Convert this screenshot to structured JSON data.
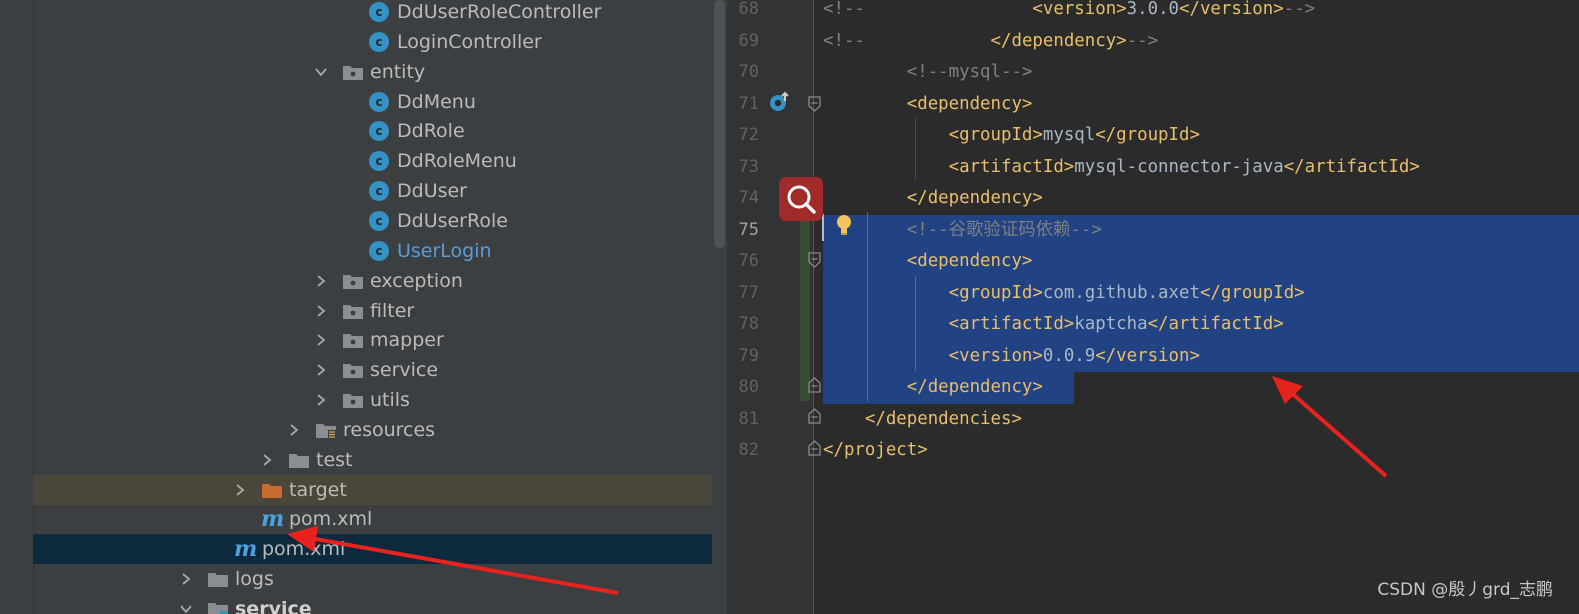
{
  "tree": {
    "items": [
      {
        "label": "DdUserRoleController",
        "icon": "class-icon",
        "expand": "none",
        "depth": 5
      },
      {
        "label": "LoginController",
        "icon": "class-icon",
        "expand": "none",
        "depth": 5
      },
      {
        "label": "entity",
        "icon": "package-icon",
        "expand": "open",
        "depth": 4
      },
      {
        "label": "DdMenu",
        "icon": "class-icon",
        "expand": "none",
        "depth": 5
      },
      {
        "label": "DdRole",
        "icon": "class-icon",
        "expand": "none",
        "depth": 5
      },
      {
        "label": "DdRoleMenu",
        "icon": "class-icon",
        "expand": "none",
        "depth": 5
      },
      {
        "label": "DdUser",
        "icon": "class-icon",
        "expand": "none",
        "depth": 5
      },
      {
        "label": "DdUserRole",
        "icon": "class-icon",
        "expand": "none",
        "depth": 5
      },
      {
        "label": "UserLogin",
        "icon": "class-icon",
        "expand": "none",
        "depth": 5,
        "style": "blue"
      },
      {
        "label": "exception",
        "icon": "package-icon",
        "expand": "closed",
        "depth": 4
      },
      {
        "label": "filter",
        "icon": "package-icon",
        "expand": "closed",
        "depth": 4
      },
      {
        "label": "mapper",
        "icon": "package-icon",
        "expand": "closed",
        "depth": 4
      },
      {
        "label": "service",
        "icon": "package-icon",
        "expand": "closed",
        "depth": 4
      },
      {
        "label": "utils",
        "icon": "package-icon",
        "expand": "closed",
        "depth": 4
      },
      {
        "label": "resources",
        "icon": "resources-folder-icon",
        "expand": "closed",
        "depth": 3
      },
      {
        "label": "test",
        "icon": "folder-icon",
        "expand": "closed",
        "depth": 2
      },
      {
        "label": "target",
        "icon": "orange-folder-icon",
        "expand": "closed",
        "depth": 1,
        "style": "target"
      },
      {
        "label": "pom.xml",
        "icon": "maven-icon",
        "expand": "none",
        "depth": 1
      },
      {
        "label": "pom.xml",
        "icon": "maven-icon",
        "expand": "none",
        "depth": 0,
        "style": "selected"
      },
      {
        "label": "logs",
        "icon": "folder-icon",
        "expand": "closed",
        "depth": -1
      },
      {
        "label": "service",
        "icon": "module-folder-icon",
        "expand": "open",
        "depth": -1,
        "style": "bold"
      }
    ]
  },
  "editor": {
    "lines": [
      {
        "n": "68",
        "tokens": [
          {
            "c": "cmt",
            "t": "<!--"
          },
          {
            "c": "cmt",
            "t": "                "
          },
          {
            "c": "tag",
            "t": "<version>"
          },
          {
            "c": "txt",
            "t": "3.0.0"
          },
          {
            "c": "tag",
            "t": "</version>"
          },
          {
            "c": "cmt",
            "t": "-->"
          }
        ]
      },
      {
        "n": "69",
        "tokens": [
          {
            "c": "cmt",
            "t": "<!--"
          },
          {
            "c": "cmt",
            "t": "            "
          },
          {
            "c": "tag",
            "t": "</dependency>"
          },
          {
            "c": "cmt",
            "t": "-->"
          }
        ]
      },
      {
        "n": "70",
        "tokens": [
          {
            "c": "cmt",
            "t": "        <!--mysql-->"
          }
        ]
      },
      {
        "n": "71",
        "tokens": [
          {
            "c": "txt",
            "t": "        "
          },
          {
            "c": "tag",
            "t": "<dependency>"
          }
        ]
      },
      {
        "n": "72",
        "tokens": [
          {
            "c": "txt",
            "t": "            "
          },
          {
            "c": "tag",
            "t": "<groupId>"
          },
          {
            "c": "txt",
            "t": "mysql"
          },
          {
            "c": "tag",
            "t": "</groupId>"
          }
        ]
      },
      {
        "n": "73",
        "tokens": [
          {
            "c": "txt",
            "t": "            "
          },
          {
            "c": "tag",
            "t": "<artifactId>"
          },
          {
            "c": "txt",
            "t": "mysql-connector-java"
          },
          {
            "c": "tag",
            "t": "</artifactId>"
          }
        ]
      },
      {
        "n": "74",
        "tokens": [
          {
            "c": "txt",
            "t": "        "
          },
          {
            "c": "tag",
            "t": "</dependency>"
          }
        ]
      },
      {
        "n": "75",
        "tokens": [
          {
            "c": "cmt",
            "t": "        <!--谷歌验证码依赖-->"
          }
        ],
        "selected": true,
        "current": true
      },
      {
        "n": "76",
        "tokens": [
          {
            "c": "txt",
            "t": "        "
          },
          {
            "c": "tag",
            "t": "<dependency>"
          }
        ],
        "selected": true
      },
      {
        "n": "77",
        "tokens": [
          {
            "c": "txt",
            "t": "            "
          },
          {
            "c": "tag",
            "t": "<groupId>"
          },
          {
            "c": "txt",
            "t": "com.github.axet"
          },
          {
            "c": "tag",
            "t": "</groupId>"
          }
        ],
        "selected": true
      },
      {
        "n": "78",
        "tokens": [
          {
            "c": "txt",
            "t": "            "
          },
          {
            "c": "tag",
            "t": "<artifactId>"
          },
          {
            "c": "txt",
            "t": "kaptcha"
          },
          {
            "c": "tag",
            "t": "</artifactId>"
          }
        ],
        "selected": true
      },
      {
        "n": "79",
        "tokens": [
          {
            "c": "txt",
            "t": "            "
          },
          {
            "c": "tag",
            "t": "<version>"
          },
          {
            "c": "txt",
            "t": "0.0.9"
          },
          {
            "c": "tag",
            "t": "</version>"
          }
        ],
        "selected": true
      },
      {
        "n": "80",
        "tokens": [
          {
            "c": "txt",
            "t": "        "
          },
          {
            "c": "tag",
            "t": "</dependency>"
          }
        ],
        "selected": "partial"
      },
      {
        "n": "81",
        "tokens": [
          {
            "c": "txt",
            "t": "    "
          },
          {
            "c": "tag",
            "t": "</dependencies>"
          }
        ]
      },
      {
        "n": "82",
        "tokens": [
          {
            "c": "tag",
            "t": "</project>"
          }
        ]
      }
    ]
  },
  "watermark": "CSDN @殷丿grd_志鹏",
  "colors": {
    "tree_bg": "#3c3f41",
    "editor_bg": "#2b2b2b",
    "selection": "#214283",
    "tag": "#e8bf6a",
    "comment": "#808080",
    "arrow": "#e8221e"
  }
}
